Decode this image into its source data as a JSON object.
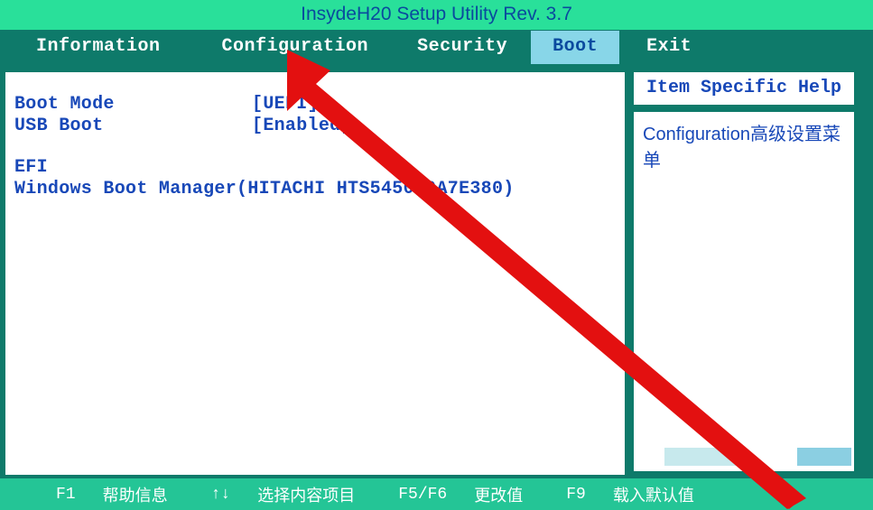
{
  "title": "InsydeH20 Setup Utility Rev. 3.7",
  "tabs": {
    "information": "Information",
    "configuration": "Configuration",
    "security": "Security",
    "boot": "Boot",
    "exit": "Exit"
  },
  "settings": {
    "boot_mode": {
      "label": "Boot Mode",
      "value": "UEFI"
    },
    "usb_boot": {
      "label": "USB Boot",
      "value": "Enabled"
    }
  },
  "efi": {
    "heading": "EFI",
    "entries": [
      "Windows Boot Manager(HITACHI HTS545050A7E380)"
    ]
  },
  "help": {
    "header": "Item Specific Help",
    "body": "Configuration高级设置菜单"
  },
  "footer": {
    "f1": {
      "key": "F1",
      "label": "帮助信息"
    },
    "arrows": {
      "key": "↑↓",
      "label": "选择内容项目"
    },
    "f5f6": {
      "key": "F5/F6",
      "label": "更改值"
    },
    "f9": {
      "key": "F9",
      "label": "载入默认值"
    }
  }
}
